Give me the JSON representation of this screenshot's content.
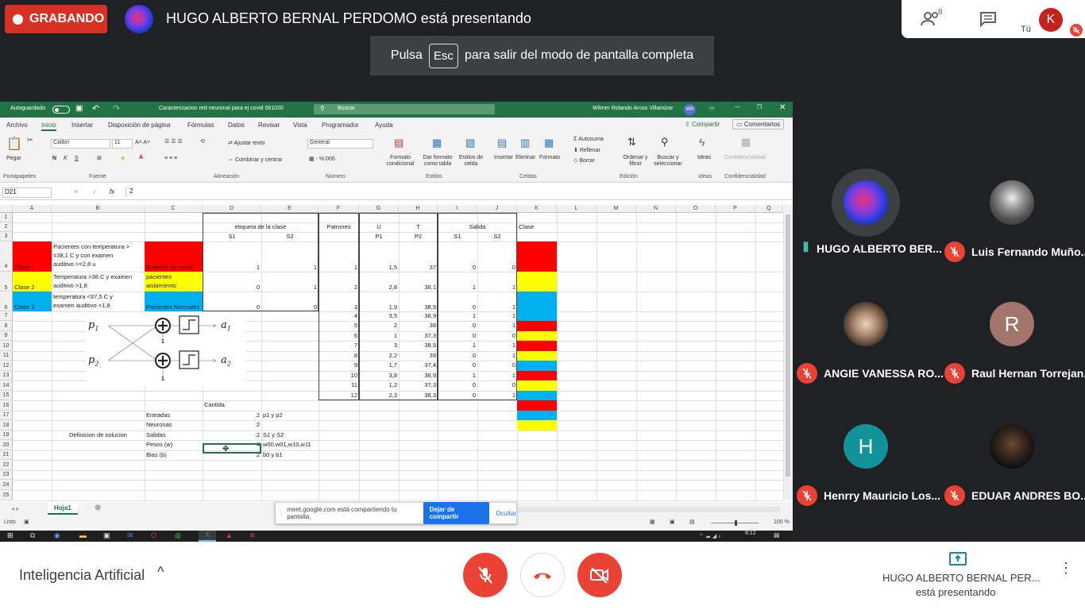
{
  "meet": {
    "recording_label": "GRABANDO",
    "presenting_title": "HUGO ALBERTO BERNAL PERDOMO está presentando",
    "participant_count": "8",
    "self_label": "Tú",
    "self_initial": "K",
    "esc_prefix": "Pulsa",
    "esc_key": "Esc",
    "esc_suffix": "para salir del modo de pantalla completa",
    "meeting_name": "Inteligencia Artificial",
    "presenter_line1": "HUGO ALBERTO BERNAL PER...",
    "presenter_line2": "está presentando",
    "participants": [
      {
        "name": "HUGO ALBERTO BER...",
        "initial": "",
        "muted": false
      },
      {
        "name": "Luis Fernando Muño...",
        "initial": "",
        "muted": true
      },
      {
        "name": "ANGIE VANESSA RO...",
        "initial": "",
        "muted": true
      },
      {
        "name": "Raul Hernan Torrejan...",
        "initial": "R",
        "muted": true
      },
      {
        "name": "Henrry Mauricio Los...",
        "initial": "H",
        "muted": true
      },
      {
        "name": "EDUAR ANDRES BO...",
        "initial": "",
        "muted": true
      }
    ],
    "colors": {
      "red": "#ea4335",
      "rec_red": "#d93025",
      "teal": "#12939a",
      "raul": "#a1756b"
    }
  },
  "excel": {
    "autosave": "Autoguardado",
    "filename": "Caracterizacion red neuronal para ej covid 081020",
    "search": "Buscar",
    "user": "Wilmer Rolando Arcos Villamizar",
    "user_initials": "WR",
    "menu": [
      "Archivo",
      "Inicio",
      "Insertar",
      "Disposición de página",
      "Fórmulas",
      "Datos",
      "Revisar",
      "Vista",
      "Programador",
      "Ayuda"
    ],
    "share": "Compartir",
    "comments": "Comentarios",
    "ribbon": {
      "paste": "Pegar",
      "font": "Calibri",
      "size": "11",
      "wrap": "Ajustar texto",
      "merge": "Combinar y centrar",
      "number_format": "General",
      "cond_format": "Formato condicional",
      "table_format": "Dar formato como tabla",
      "cell_styles": "Estilos de celda",
      "insert": "Insertar",
      "delete": "Eliminar",
      "format": "Formato",
      "autosum": "Autosuma",
      "fill": "Rellenar",
      "clear": "Borrar",
      "sort": "Ordenar y filtrar",
      "find": "Buscar y seleccionar",
      "ideas": "Ideas",
      "sensitivity": "Confidencialidad",
      "groups": [
        "Portapapeles",
        "Fuente",
        "Alineación",
        "Número",
        "Estilos",
        "Celdas",
        "Edición",
        "Ideas",
        "Confidencialidad"
      ]
    },
    "namebox": "D21",
    "formula": "2",
    "columns": [
      "A",
      "B",
      "C",
      "D",
      "E",
      "F",
      "G",
      "H",
      "I",
      "J",
      "K",
      "L",
      "M",
      "N",
      "O",
      "P",
      "Q"
    ],
    "rows": [
      "1",
      "2",
      "3",
      "4",
      "5",
      "6",
      "7",
      "8",
      "9",
      "10",
      "11",
      "12",
      "13",
      "14",
      "15",
      "16",
      "17",
      "18",
      "19",
      "20",
      "21",
      "22",
      "23",
      "24",
      "25"
    ],
    "headers": {
      "etiqueta": "etiqueta de la clase",
      "patrones": "Patrones",
      "u": "U",
      "t": "T",
      "salida": "Salida",
      "clase": "Clase",
      "s1": "S1",
      "s2": "S2",
      "p1": "P1",
      "p2": "P2"
    },
    "classes": [
      {
        "label": "Clase 1",
        "desc1": "Pacientes con temperatura >",
        "desc2": "=38,1 C y con examen",
        "desc3": "auditivo >=2,8 u",
        "c": "Enfermo de covid",
        "c2": "",
        "s1": "1",
        "s2": "1",
        "color": "#ff0000"
      },
      {
        "label": "Clase 2",
        "desc1": "Temperatura >38 C y examen",
        "desc2": "auditivo >1,8",
        "desc3": "",
        "c": "pacientes",
        "c2": "aislamiento",
        "s1": "0",
        "s2": "1",
        "color": "#ffff00"
      },
      {
        "label": "Clase 3",
        "desc1": "temperatura <37,5 C y",
        "desc2": "examen auditivo <1,8",
        "desc3": "",
        "c": "Pacientes Normales",
        "c2": "",
        "s1": "0",
        "s2": "0",
        "color": "#00b0f0"
      }
    ],
    "patterns": [
      {
        "n": "1",
        "p1": "1,5",
        "p2": "37",
        "s1": "0",
        "s2": "0",
        "color": "#00b0f0"
      },
      {
        "n": "2",
        "p1": "2,8",
        "p2": "38,1",
        "s1": "1",
        "s2": "1",
        "color": "#ff0000"
      },
      {
        "n": "3",
        "p1": "1,9",
        "p2": "38,5",
        "s1": "0",
        "s2": "1",
        "color": "#ffff00"
      },
      {
        "n": "4",
        "p1": "3,5",
        "p2": "38,9",
        "s1": "1",
        "s2": "1",
        "color": "#ff0000"
      },
      {
        "n": "5",
        "p1": "2",
        "p2": "38",
        "s1": "0",
        "s2": "1",
        "color": "#ffff00"
      },
      {
        "n": "6",
        "p1": "1",
        "p2": "37,3",
        "s1": "0",
        "s2": "0",
        "color": "#00b0f0"
      },
      {
        "n": "7",
        "p1": "3",
        "p2": "38,5",
        "s1": "1",
        "s2": "1",
        "color": "#ff0000"
      },
      {
        "n": "8",
        "p1": "2,2",
        "p2": "39",
        "s1": "0",
        "s2": "1",
        "color": "#ffff00"
      },
      {
        "n": "9",
        "p1": "1,7",
        "p2": "37,4",
        "s1": "0",
        "s2": "0",
        "color": "#00b0f0"
      },
      {
        "n": "10",
        "p1": "3,8",
        "p2": "38,9",
        "s1": "1",
        "s2": "1",
        "color": "#ff0000"
      },
      {
        "n": "11",
        "p1": "1,2",
        "p2": "37,3",
        "s1": "0",
        "s2": "0",
        "color": "#00b0f0"
      },
      {
        "n": "12",
        "p1": "2,3",
        "p2": "38,3",
        "s1": "0",
        "s2": "1",
        "color": "#ffff00"
      }
    ],
    "diagram": {
      "p1": "p",
      "p1_sub": "1",
      "p2": "p",
      "p2_sub": "2",
      "a1": "a",
      "a1_sub": "1",
      "a2": "a",
      "a2_sub": "2",
      "bias": "1"
    },
    "solution": {
      "title": "Definicion de solucion",
      "cantida": "Cantida",
      "rows": [
        {
          "label": "Entradas",
          "value": "2",
          "detail": "p1 y p2"
        },
        {
          "label": "Neuronas",
          "value": "2",
          "detail": ""
        },
        {
          "label": "Salidas",
          "value": "2",
          "detail": "S1 y S2"
        },
        {
          "label": "Pesos (w)",
          "value": "4",
          "detail": "w00,w01,w10,w11"
        },
        {
          "label": "Bias (b)",
          "value": "2",
          "detail": "b0 y b1"
        }
      ]
    },
    "sheet_tab": "Hoja1",
    "status": "Listo",
    "zoom": "100 %",
    "share_notice": "meet.google.com está compartiendo tu pantalla.",
    "stop_sharing": "Dejar de compartir",
    "hide": "Ocultar",
    "clock": "8:12"
  }
}
